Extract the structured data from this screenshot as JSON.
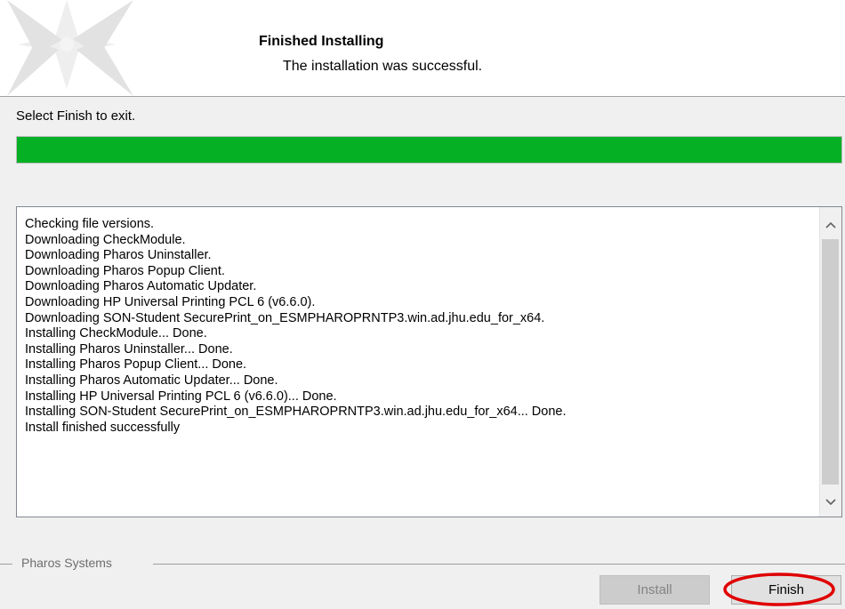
{
  "header": {
    "title": "Finished Installing",
    "subtitle": "The installation was successful."
  },
  "instruction": "Select Finish to exit.",
  "progress": {
    "percent": 100,
    "color": "#06b025"
  },
  "log": {
    "lines": [
      "Checking file versions.",
      "Downloading CheckModule.",
      "Downloading Pharos Uninstaller.",
      "Downloading Pharos Popup Client.",
      "Downloading Pharos Automatic Updater.",
      "Downloading HP Universal Printing PCL 6 (v6.6.0).",
      "Downloading SON-Student SecurePrint_on_ESMPHAROPRNTP3.win.ad.jhu.edu_for_x64.",
      "Installing CheckModule... Done.",
      "Installing Pharos Uninstaller... Done.",
      "Installing Pharos Popup Client... Done.",
      "Installing Pharos Automatic Updater... Done.",
      "Installing HP Universal Printing PCL 6 (v6.6.0)... Done.",
      "Installing SON-Student SecurePrint_on_ESMPHAROPRNTP3.win.ad.jhu.edu_for_x64... Done.",
      "Install finished successfully"
    ],
    "scroll_up_icon": "chevron-up-icon",
    "scroll_down_icon": "chevron-down-icon"
  },
  "footer": {
    "group_label": "Pharos Systems",
    "install_label": "Install",
    "finish_label": "Finish",
    "highlight_color": "#e00000"
  }
}
